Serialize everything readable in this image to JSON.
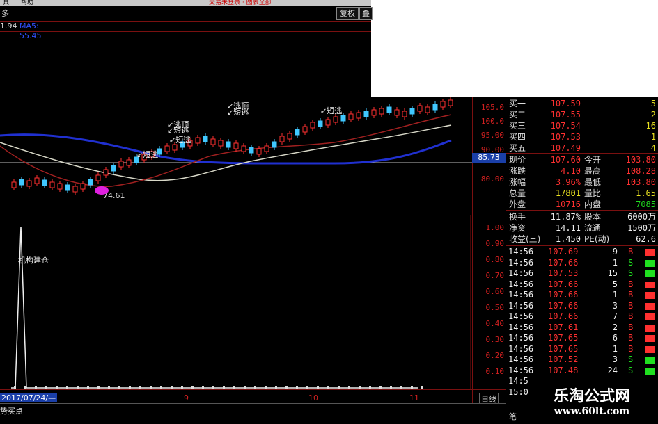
{
  "menubar": {
    "left_text": "具",
    "help": "帮助",
    "center_text": "交易未登录 · 图表全部"
  },
  "toolbar": {
    "left_label": "多",
    "fq_button": "复权",
    "more_button": "叠"
  },
  "indicator_header": {
    "value": "1.94",
    "ma_text": "MA5: 55.45"
  },
  "chart_annotations": {
    "short_escape": "短逃",
    "top_escape": "逃顶",
    "low_price": "74.61",
    "institution_build": "机构建仓"
  },
  "price_scale": [
    "105.0",
    "100.0",
    "95.00",
    "90.00",
    "85.73",
    "80.00"
  ],
  "current_price_tag": "85.73",
  "indicator_scale": [
    "1.00",
    "0.90",
    "0.80",
    "0.70",
    "0.60",
    "0.50",
    "0.40",
    "0.30",
    "0.20",
    "0.10"
  ],
  "order_book": [
    {
      "label": "买一",
      "price": "107.59",
      "vol": "5"
    },
    {
      "label": "买二",
      "price": "107.55",
      "vol": "2"
    },
    {
      "label": "买三",
      "price": "107.54",
      "vol": "16"
    },
    {
      "label": "买四",
      "price": "107.53",
      "vol": "1"
    },
    {
      "label": "买五",
      "price": "107.49",
      "vol": "4"
    }
  ],
  "quote": [
    {
      "l1": "现价",
      "v1": "107.60",
      "l2": "今开",
      "v2": "103.80"
    },
    {
      "l1": "涨跌",
      "v1": "4.10",
      "l2": "最高",
      "v2": "108.28"
    },
    {
      "l1": "涨幅",
      "v1": "3.96%",
      "l2": "最低",
      "v2": "103.80"
    },
    {
      "l1": "总量",
      "v1": "17801",
      "l2": "量比",
      "v2": "1.65"
    },
    {
      "l1": "外盘",
      "v1": "10716",
      "l2": "内盘",
      "v2": "7085"
    }
  ],
  "fundamentals": [
    {
      "l1": "换手",
      "v1": "11.87%",
      "l2": "股本",
      "v2": "6000万"
    },
    {
      "l1": "净资",
      "v1": "14.11",
      "l2": "流通",
      "v2": "1500万"
    },
    {
      "l1": "收益(三)",
      "v1": "1.450",
      "l2": "PE(动)",
      "v2": "62.6"
    }
  ],
  "ticks": [
    {
      "time": "14:56",
      "price": "107.69",
      "vol": "9",
      "bs": "B"
    },
    {
      "time": "14:56",
      "price": "107.66",
      "vol": "1",
      "bs": "S"
    },
    {
      "time": "14:56",
      "price": "107.53",
      "vol": "15",
      "bs": "S"
    },
    {
      "time": "14:56",
      "price": "107.66",
      "vol": "5",
      "bs": "B"
    },
    {
      "time": "14:56",
      "price": "107.66",
      "vol": "1",
      "bs": "B"
    },
    {
      "time": "14:56",
      "price": "107.66",
      "vol": "3",
      "bs": "B"
    },
    {
      "time": "14:56",
      "price": "107.66",
      "vol": "7",
      "bs": "B"
    },
    {
      "time": "14:56",
      "price": "107.61",
      "vol": "2",
      "bs": "B"
    },
    {
      "time": "14:56",
      "price": "107.65",
      "vol": "6",
      "bs": "B"
    },
    {
      "time": "14:56",
      "price": "107.65",
      "vol": "1",
      "bs": "B"
    },
    {
      "time": "14:56",
      "price": "107.52",
      "vol": "3",
      "bs": "S"
    },
    {
      "time": "14:56",
      "price": "107.48",
      "vol": "24",
      "bs": "S"
    },
    {
      "time": "14:5",
      "price": "",
      "vol": "",
      "bs": ""
    },
    {
      "time": "15:0",
      "price": "",
      "vol": "",
      "bs": ""
    }
  ],
  "bottom_axis": {
    "date": "2017/07/24/—",
    "m9": "9",
    "m10": "10",
    "m11": "11",
    "period": "日线"
  },
  "bottom_tab": {
    "label": "势买点"
  },
  "side_tab": "笔",
  "watermark": {
    "title": "乐淘公式网",
    "url": "www.60lt.com"
  },
  "colors": {
    "up": "#ff3030",
    "down": "#20e020",
    "ma_blue": "#2030d0",
    "ma_white": "#d8d8c8",
    "ma_red": "#a02020",
    "grid": "#7a1010"
  }
}
